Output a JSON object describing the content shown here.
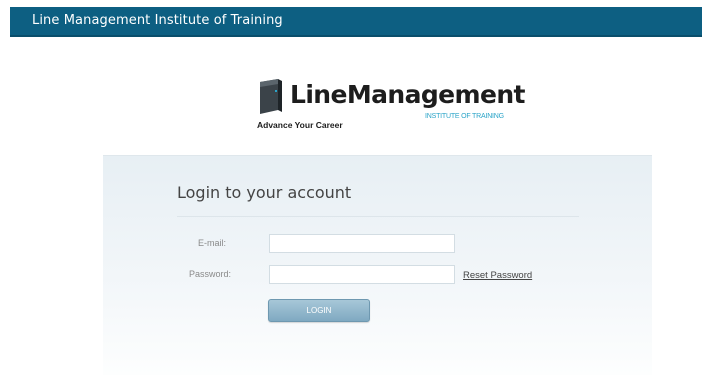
{
  "header": {
    "title": "Line Management Institute of Training"
  },
  "logo": {
    "name": "LineManagement",
    "subtitle": "INSTITUTE OF TRAINING",
    "tagline": "Advance Your Career",
    "icon": "book-icon"
  },
  "login": {
    "title": "Login to your account",
    "email_label": "E-mail:",
    "email_value": "",
    "password_label": "Password:",
    "password_value": "",
    "reset_label": "Reset Password",
    "login_label": "LOGIN"
  },
  "colors": {
    "header_bg": "#0d5f82",
    "accent": "#2aa4c8",
    "button": "#8fb5cb"
  }
}
